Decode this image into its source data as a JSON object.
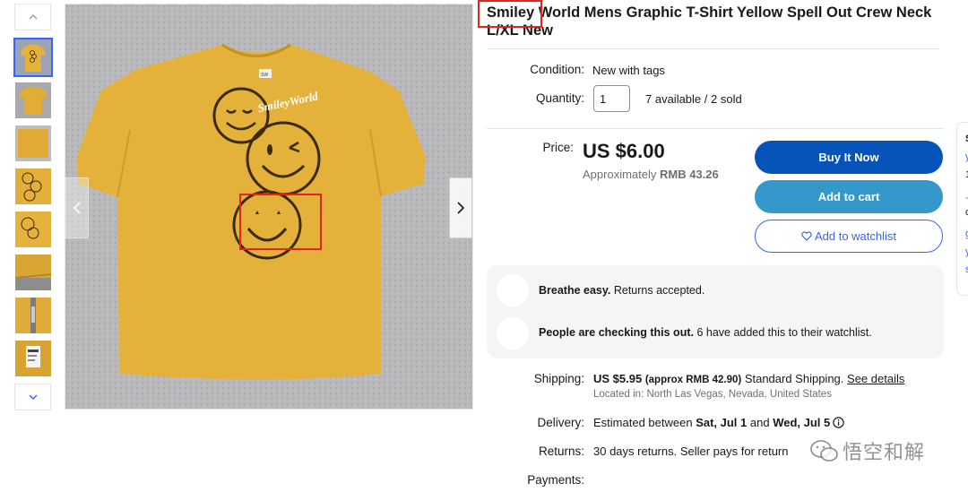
{
  "gallery": {
    "thumbnail_count": 8,
    "active_index": 0
  },
  "main_image": {
    "print_text": "SmileyWorld",
    "tag_text": "SW"
  },
  "listing": {
    "title": "Smiley World Mens Graphic T-Shirt Yellow Spell Out Crew Neck L/XL New",
    "condition_label": "Condition:",
    "condition_value": "New with tags",
    "quantity_label": "Quantity:",
    "quantity_value": "1",
    "availability": "7 available / 2 sold",
    "price_label": "Price:",
    "price": "US $6.00",
    "approx_prefix": "Approximately",
    "approx_value": "RMB 43.26"
  },
  "actions": {
    "buy_now": "Buy It Now",
    "add_to_cart": "Add to cart",
    "add_to_watchlist": "Add to watchlist"
  },
  "highlights": {
    "returns_bold": "Breathe easy.",
    "returns_text": " Returns accepted.",
    "watchers_bold": "People are checking this out.",
    "watchers_text": " 6 have added this to their watchlist."
  },
  "shipping": {
    "label": "Shipping:",
    "price": "US $5.95",
    "approx": "(approx RMB 42.90)",
    "method": "Standard Shipping.",
    "details_link": "See details",
    "location": "Located in: North Las Vegas, Nevada, United States"
  },
  "delivery": {
    "label": "Delivery:",
    "prefix": "Estimated between ",
    "start": "Sat, Jul 1",
    "middle": " and ",
    "end": "Wed, Jul 5"
  },
  "returns": {
    "label": "Returns:",
    "text": "30 days returns. Seller pays for return"
  },
  "payments": {
    "label": "Payments:"
  },
  "right_card": {
    "letters": [
      "S",
      "y",
      "1",
      "-",
      "c",
      "g",
      "y",
      "s"
    ]
  },
  "watermark": {
    "text": "悟空和解"
  },
  "colors": {
    "primary_button": "#0654ba",
    "secondary_button": "#3498ca",
    "link_blue": "#3665f3",
    "annotation_red": "#e0261c",
    "shirt_yellow": "#e4b13a"
  }
}
